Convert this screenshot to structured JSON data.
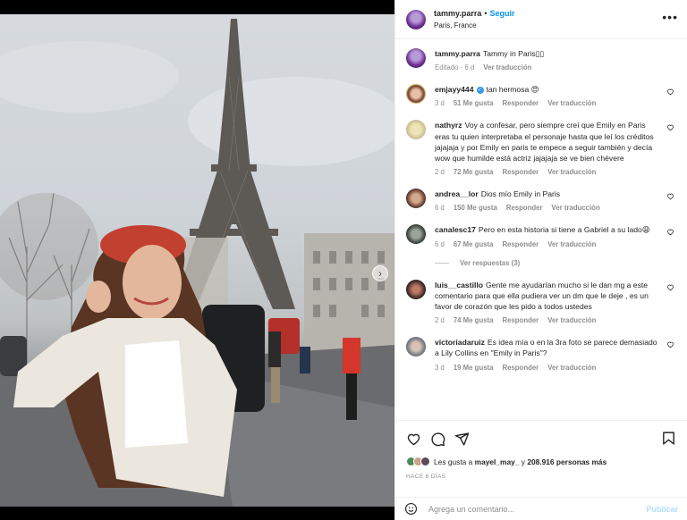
{
  "header": {
    "username": "tammy.parra",
    "separator": "•",
    "follow_label": "Seguir",
    "location": "Paris, France",
    "more_label": "•••"
  },
  "caption": {
    "username": "tammy.parra",
    "text": "Tammy in Paris▯▯",
    "edited": "Editado · 6 d",
    "translate": "Ver traducción"
  },
  "comments": [
    {
      "username": "emjayy444",
      "verified": true,
      "text": "tan hermosa 😍",
      "age": "3 d",
      "likes": "51 Me gusta",
      "reply": "Responder",
      "translate": "Ver traducción"
    },
    {
      "username": "nathyrz",
      "text": "Voy a confesar, pero siempre creí que Emily en Paris eras tu quien interpretaba el personaje hasta que leí los créditos jajajaja y por Emily en paris te empece a seguir también y decía wow que humilde está actriz jajajaja se ve bien chévere",
      "age": "2 d",
      "likes": "72 Me gusta",
      "reply": "Responder",
      "translate": "Ver traducción"
    },
    {
      "username": "andrea__lor",
      "text": "Dios mío Emily in Paris",
      "age": "6 d",
      "likes": "150 Me gusta",
      "reply": "Responder",
      "translate": "Ver traducción"
    },
    {
      "username": "canalesc17",
      "text": "Pero en esta historia si tiene a Gabriel a su lado😩",
      "age": "6 d",
      "likes": "67 Me gusta",
      "reply": "Responder",
      "translate": "Ver traducción",
      "replies_label": "Ver respuestas (3)"
    },
    {
      "username": "luis__castillo",
      "text": "Gente me ayudarían mucho si le dan mg a este comentario para que ella pudiera ver un dm que le deje , es un favor de corazón que les pido a todos ustedes",
      "age": "2 d",
      "likes": "74 Me gusta",
      "reply": "Responder",
      "translate": "Ver traducción"
    },
    {
      "username": "victoriadaruiz",
      "text": "Es idea mía o en la 3ra foto se parece demasiado a Lily Collins en \"Emily in Paris\"?",
      "age": "3 d",
      "likes": "19 Me gusta",
      "reply": "Responder",
      "translate": "Ver traducción"
    }
  ],
  "likes": {
    "prefix": "Les gusta a",
    "user": "mayel_may_",
    "joiner": "y",
    "count": "208.916 personas más"
  },
  "posted_ago": "HACE 6 DÍAS",
  "composer": {
    "placeholder": "Agrega un comentario...",
    "publish_label": "Publicar"
  },
  "colors": {
    "accent": "#0095f6",
    "publish_disabled": "#b2dffc",
    "muted": "#8e8e8e"
  }
}
